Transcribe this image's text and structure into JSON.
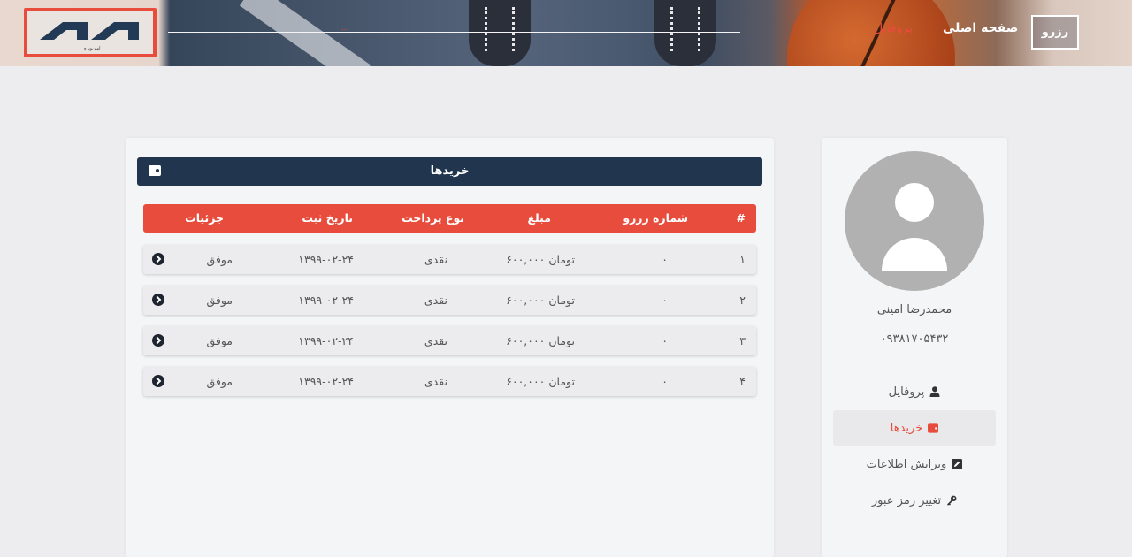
{
  "header": {
    "logo_subtitle": "امین‌ویژه",
    "nav_profile": "پروفایل",
    "nav_home": "صفحه اصلی",
    "reserve_button": "رزرو",
    "accent_color": "#e84c3d"
  },
  "sidebar": {
    "user_name": "محمدرضا امینی",
    "user_phone": "۰۹۳۸۱۷۰۵۴۳۲",
    "menu": [
      {
        "label": "پروفایل",
        "icon": "user-icon",
        "active": false
      },
      {
        "label": "خریدها",
        "icon": "wallet-icon",
        "active": true
      },
      {
        "label": "ویرایش اطلاعات",
        "icon": "edit-icon",
        "active": false
      },
      {
        "label": "تغییر رمز عبور",
        "icon": "key-icon",
        "active": false
      }
    ]
  },
  "main": {
    "section_title": "خریدها",
    "columns": {
      "index": "#",
      "reservation_number": "شماره رزرو",
      "amount": "مبلغ",
      "payment_type": "نوع پرداخت",
      "date": "تاریخ ثبت",
      "details": "جزئیات"
    },
    "rows": [
      {
        "index": "۱",
        "reservation_number": "۰",
        "amount": "۶۰۰,۰۰۰ تومان",
        "payment_type": "نقدی",
        "date": "۱۳۹۹-۰۲-۲۴",
        "status": "موفق"
      },
      {
        "index": "۲",
        "reservation_number": "۰",
        "amount": "۶۰۰,۰۰۰ تومان",
        "payment_type": "نقدی",
        "date": "۱۳۹۹-۰۲-۲۴",
        "status": "موفق"
      },
      {
        "index": "۳",
        "reservation_number": "۰",
        "amount": "۶۰۰,۰۰۰ تومان",
        "payment_type": "نقدی",
        "date": "۱۳۹۹-۰۲-۲۴",
        "status": "موفق"
      },
      {
        "index": "۴",
        "reservation_number": "۰",
        "amount": "۶۰۰,۰۰۰ تومان",
        "payment_type": "نقدی",
        "date": "۱۳۹۹-۰۲-۲۴",
        "status": "موفق"
      }
    ]
  }
}
